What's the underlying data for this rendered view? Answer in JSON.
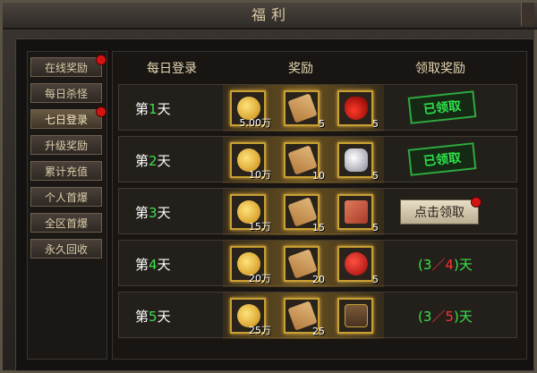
{
  "window": {
    "title": "福利"
  },
  "sidebar": {
    "items": [
      {
        "label": "在线奖励",
        "badge": true,
        "active": false
      },
      {
        "label": "每日杀怪",
        "badge": false,
        "active": false
      },
      {
        "label": "七日登录",
        "badge": true,
        "active": true
      },
      {
        "label": "升级奖励",
        "badge": false,
        "active": false
      },
      {
        "label": "累计充值",
        "badge": false,
        "active": false
      },
      {
        "label": "个人首爆",
        "badge": false,
        "active": false
      },
      {
        "label": "全区首爆",
        "badge": false,
        "active": false
      },
      {
        "label": "永久回收",
        "badge": false,
        "active": false
      }
    ]
  },
  "table": {
    "headers": [
      "每日登录",
      "奖励",
      "领取奖励"
    ],
    "rows": [
      {
        "day_prefix": "第",
        "day_num": "1",
        "day_suffix": "天",
        "rewards": [
          {
            "icon": "gold-coins-icon",
            "qty": "5.00万"
          },
          {
            "icon": "scroll-icon",
            "qty": "5"
          },
          {
            "icon": "red-potion-icon",
            "qty": "5"
          }
        ],
        "status": "claimed",
        "stamp_text": "已领取"
      },
      {
        "day_prefix": "第",
        "day_num": "2",
        "day_suffix": "天",
        "rewards": [
          {
            "icon": "gold-coins-icon",
            "qty": "10万"
          },
          {
            "icon": "scroll-icon",
            "qty": "10"
          },
          {
            "icon": "diamond-icon",
            "qty": "5"
          }
        ],
        "status": "claimed",
        "stamp_text": "已领取"
      },
      {
        "day_prefix": "第",
        "day_num": "3",
        "day_suffix": "天",
        "rewards": [
          {
            "icon": "gold-coins-icon",
            "qty": "15万"
          },
          {
            "icon": "scroll-icon",
            "qty": "15"
          },
          {
            "icon": "skill-book-icon",
            "qty": "5"
          }
        ],
        "status": "claimable",
        "button_label": "点击领取"
      },
      {
        "day_prefix": "第",
        "day_num": "4",
        "day_suffix": "天",
        "rewards": [
          {
            "icon": "gold-coins-icon",
            "qty": "20万"
          },
          {
            "icon": "scroll-icon",
            "qty": "20"
          },
          {
            "icon": "apple-icon",
            "qty": "5"
          }
        ],
        "status": "progress",
        "progress_open": "(",
        "progress_current": "3",
        "progress_sep": "／",
        "progress_total": "4",
        "progress_close": ")天"
      },
      {
        "day_prefix": "第",
        "day_num": "5",
        "day_suffix": "天",
        "rewards": [
          {
            "icon": "gold-coins-icon",
            "qty": "25万"
          },
          {
            "icon": "scroll-icon",
            "qty": "25"
          },
          {
            "icon": "treasure-chest-icon",
            "qty": ""
          }
        ],
        "status": "progress",
        "progress_open": "(",
        "progress_current": "3",
        "progress_sep": "／",
        "progress_total": "5",
        "progress_close": ")天"
      }
    ]
  }
}
